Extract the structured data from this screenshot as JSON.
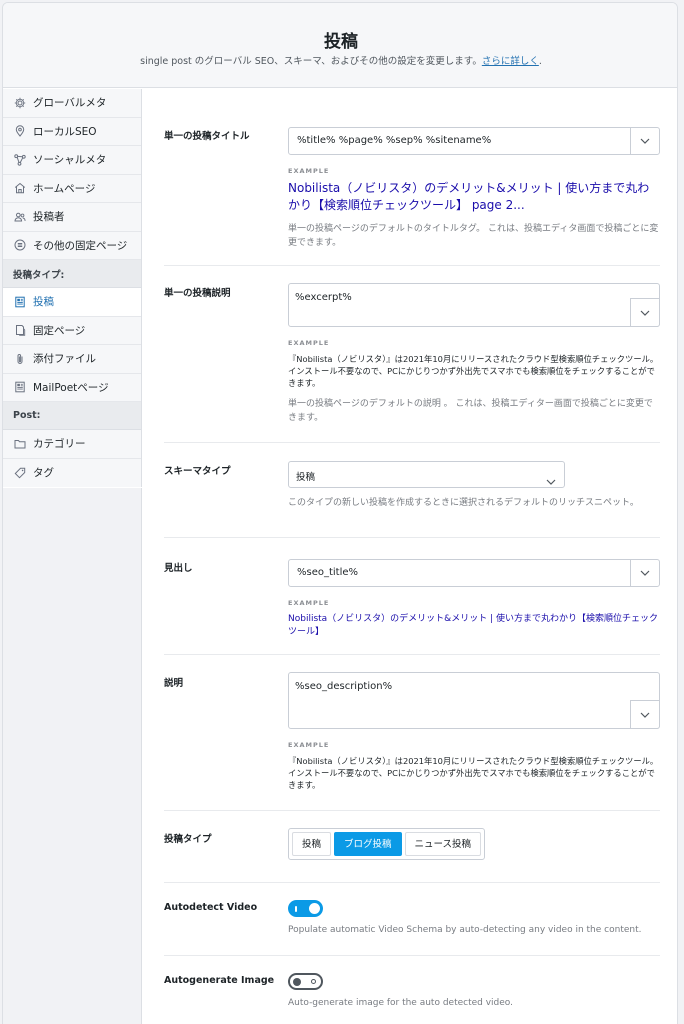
{
  "header": {
    "title": "投稿",
    "subtitle": "single post のグローバル SEO、スキーマ、およびその他の設定を変更します。",
    "link": "さらに詳しく",
    "period": "."
  },
  "sidebar": {
    "items": [
      {
        "label": "グローバルメタ",
        "icon": "gear-icon"
      },
      {
        "label": "ローカルSEO",
        "icon": "location-pin-icon"
      },
      {
        "label": "ソーシャルメタ",
        "icon": "share-icon"
      },
      {
        "label": "ホームページ",
        "icon": "home-icon"
      },
      {
        "label": "投稿者",
        "icon": "users-icon"
      },
      {
        "label": "その他の固定ページ",
        "icon": "list-circle-icon"
      }
    ],
    "group_post_types": "投稿タイプ:",
    "post_type_items": [
      {
        "label": "投稿",
        "icon": "post-icon",
        "active": true
      },
      {
        "label": "固定ページ",
        "icon": "page-icon"
      },
      {
        "label": "添付ファイル",
        "icon": "paperclip-icon"
      },
      {
        "label": "MailPoetページ",
        "icon": "mailpoet-icon"
      }
    ],
    "group_post": "Post:",
    "post_items": [
      {
        "label": "カテゴリー",
        "icon": "folder-icon"
      },
      {
        "label": "タグ",
        "icon": "tag-icon"
      }
    ]
  },
  "settings": {
    "title": {
      "label": "単一の投稿タイトル",
      "value": "%title% %page% %sep% %sitename%",
      "example_label": "EXAMPLE",
      "example": "Nobilista（ノビリスタ）のデメリット&メリット | 使い方まで丸わかり【検索順位チェックツール】 page 2...",
      "help": "単一の投稿ページのデフォルトのタイトルタグ。 これは、投稿エディタ画面で投稿ごとに変更できます。"
    },
    "description": {
      "label": "単一の投稿説明",
      "value": "%excerpt%",
      "example_label": "EXAMPLE",
      "example": "『Nobilista（ノビリスタ）』は2021年10月にリリースされたクラウド型検索順位チェックツール。インストール不要なので、PCにかじりつかず外出先でスマホでも検索順位をチェックすることができます。",
      "help": "単一の投稿ページのデフォルトの説明 。 これは、投稿エディター画面で投稿ごとに変更できます。"
    },
    "schema": {
      "label": "スキーマタイプ",
      "value": "投稿",
      "help": "このタイプの新しい投稿を作成するときに選択されるデフォルトのリッチスニペット。"
    },
    "headline": {
      "label": "見出し",
      "value": "%seo_title%",
      "example_label": "EXAMPLE",
      "example": "Nobilista（ノビリスタ）のデメリット&メリット | 使い方まで丸わかり【検索順位チェックツール】"
    },
    "schema_desc": {
      "label": "説明",
      "value": "%seo_description%",
      "example_label": "EXAMPLE",
      "example": "『Nobilista（ノビリスタ）』は2021年10月にリリースされたクラウド型検索順位チェックツール。インストール不要なので、PCにかじりつかず外出先でスマホでも検索順位をチェックすることができます。"
    },
    "article_type": {
      "label": "投稿タイプ",
      "options": [
        "投稿",
        "ブログ投稿",
        "ニュース投稿"
      ],
      "selected": "ブログ投稿"
    },
    "autodetect_video": {
      "label": "Autodetect Video",
      "enabled": true,
      "help": "Populate automatic Video Schema by auto-detecting any video in the content."
    },
    "autogenerate_image": {
      "label": "Autogenerate Image",
      "enabled": false,
      "help": "Auto-generate image for the auto detected video."
    }
  },
  "colors": {
    "accent": "#0b9ae6",
    "link": "#2271b1",
    "example_link": "#1a0dab"
  }
}
